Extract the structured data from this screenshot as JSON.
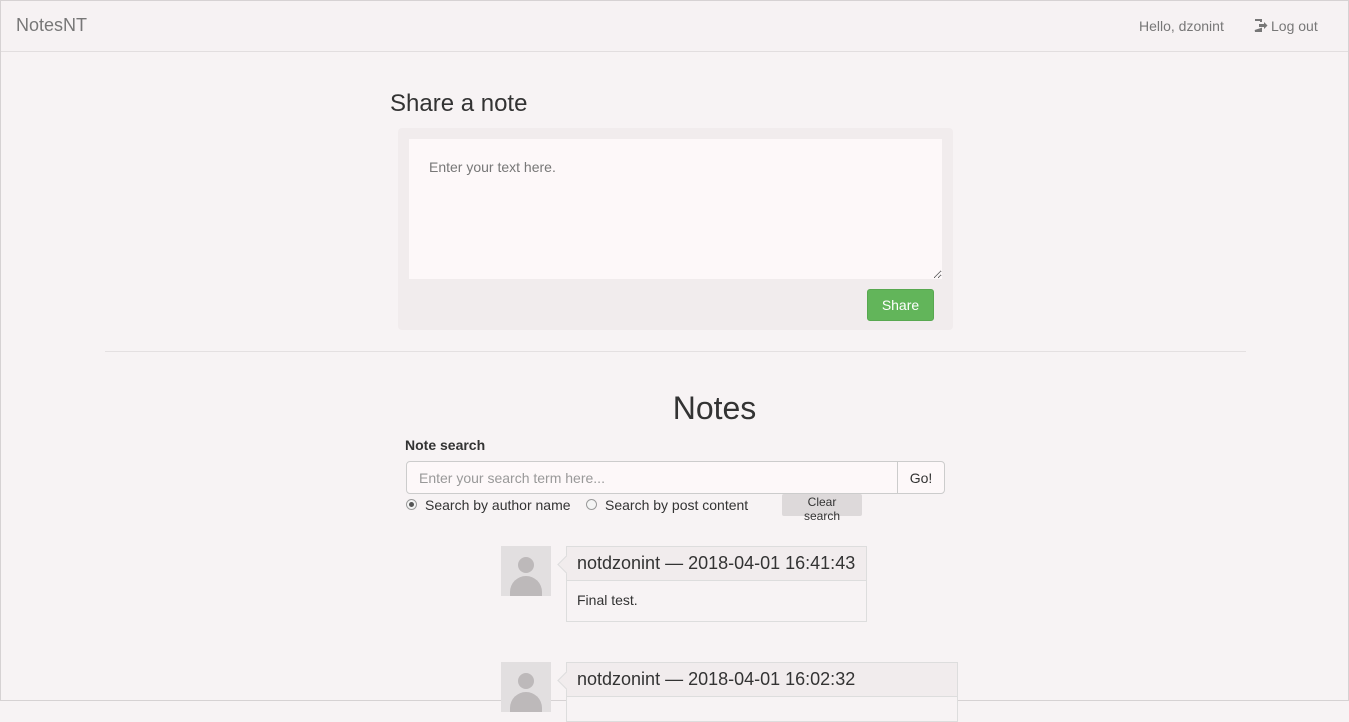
{
  "navbar": {
    "brand": "NotesNT",
    "greeting": "Hello, dzonint",
    "logout_label": "Log out"
  },
  "share": {
    "title": "Share a note",
    "placeholder": "Enter your text here.",
    "button_label": "Share"
  },
  "notes": {
    "title": "Notes",
    "search_label": "Note search",
    "search_placeholder": "Enter your search term here...",
    "go_label": "Go!",
    "radio_author_label": "Search by author name",
    "radio_content_label": "Search by post content",
    "selected_search_mode": "Search by author name",
    "clear_label": "Clear search",
    "items": [
      {
        "header": "notdzonint — 2018-04-01 16:41:43",
        "body": "Final test."
      },
      {
        "header": "notdzonint — 2018-04-01 16:02:32",
        "body": ""
      }
    ]
  },
  "colors": {
    "accent_green": "#62b55a",
    "background": "#f7f3f4"
  },
  "icons": {
    "logout": "log-out-icon",
    "avatar": "user-placeholder-icon"
  }
}
